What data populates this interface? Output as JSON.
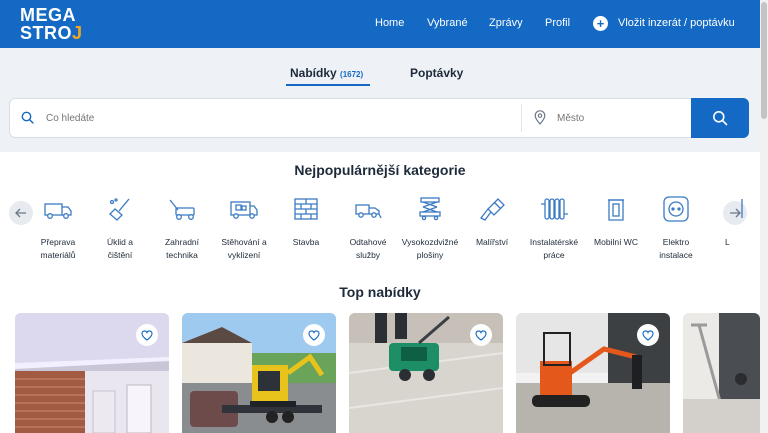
{
  "header": {
    "logo_line1": "MEGA",
    "logo_line2": "STRO",
    "nav": [
      "Home",
      "Vybrané",
      "Zprávy",
      "Profil"
    ],
    "post_label": "Vložit  inzerát / poptávku"
  },
  "tabs": [
    {
      "label": "Nabídky",
      "count": "(1672)",
      "active": true
    },
    {
      "label": "Poptávky",
      "count": "",
      "active": false
    }
  ],
  "search": {
    "placeholder": "Co hledáte",
    "city_placeholder": "Město"
  },
  "categories_title": "Nejpopulárnější kategorie",
  "categories": [
    {
      "line1": "Přeprava",
      "line2": "materiálů",
      "icon": "truck-icon"
    },
    {
      "line1": "Úklid a",
      "line2": "čištění",
      "icon": "cleaning-icon"
    },
    {
      "line1": "Zahradní",
      "line2": "technika",
      "icon": "lawnmower-icon"
    },
    {
      "line1": "Stěhování a",
      "line2": "vyklizení",
      "icon": "moving-truck-icon"
    },
    {
      "line1": "Stavba",
      "line2": "",
      "icon": "brick-wall-icon"
    },
    {
      "line1": "Odtahové",
      "line2": "služby",
      "icon": "tow-truck-icon"
    },
    {
      "line1": "Vysokozdvižné",
      "line2": "plošiny",
      "icon": "scissor-lift-icon"
    },
    {
      "line1": "Malířství",
      "line2": "",
      "icon": "paint-brush-icon"
    },
    {
      "line1": "Instalatérské",
      "line2": "práce",
      "icon": "radiator-icon"
    },
    {
      "line1": "Mobilní WC",
      "line2": "",
      "icon": "portable-toilet-icon"
    },
    {
      "line1": "Elektro",
      "line2": "instalace",
      "icon": "power-socket-icon"
    },
    {
      "line1": "L",
      "line2": "",
      "icon": "partial-category-icon"
    }
  ],
  "top_offers_title": "Top nabídky",
  "colors": {
    "brand": "#1369c4",
    "accent": "#f5a623",
    "page_bg": "#eef2f6"
  }
}
